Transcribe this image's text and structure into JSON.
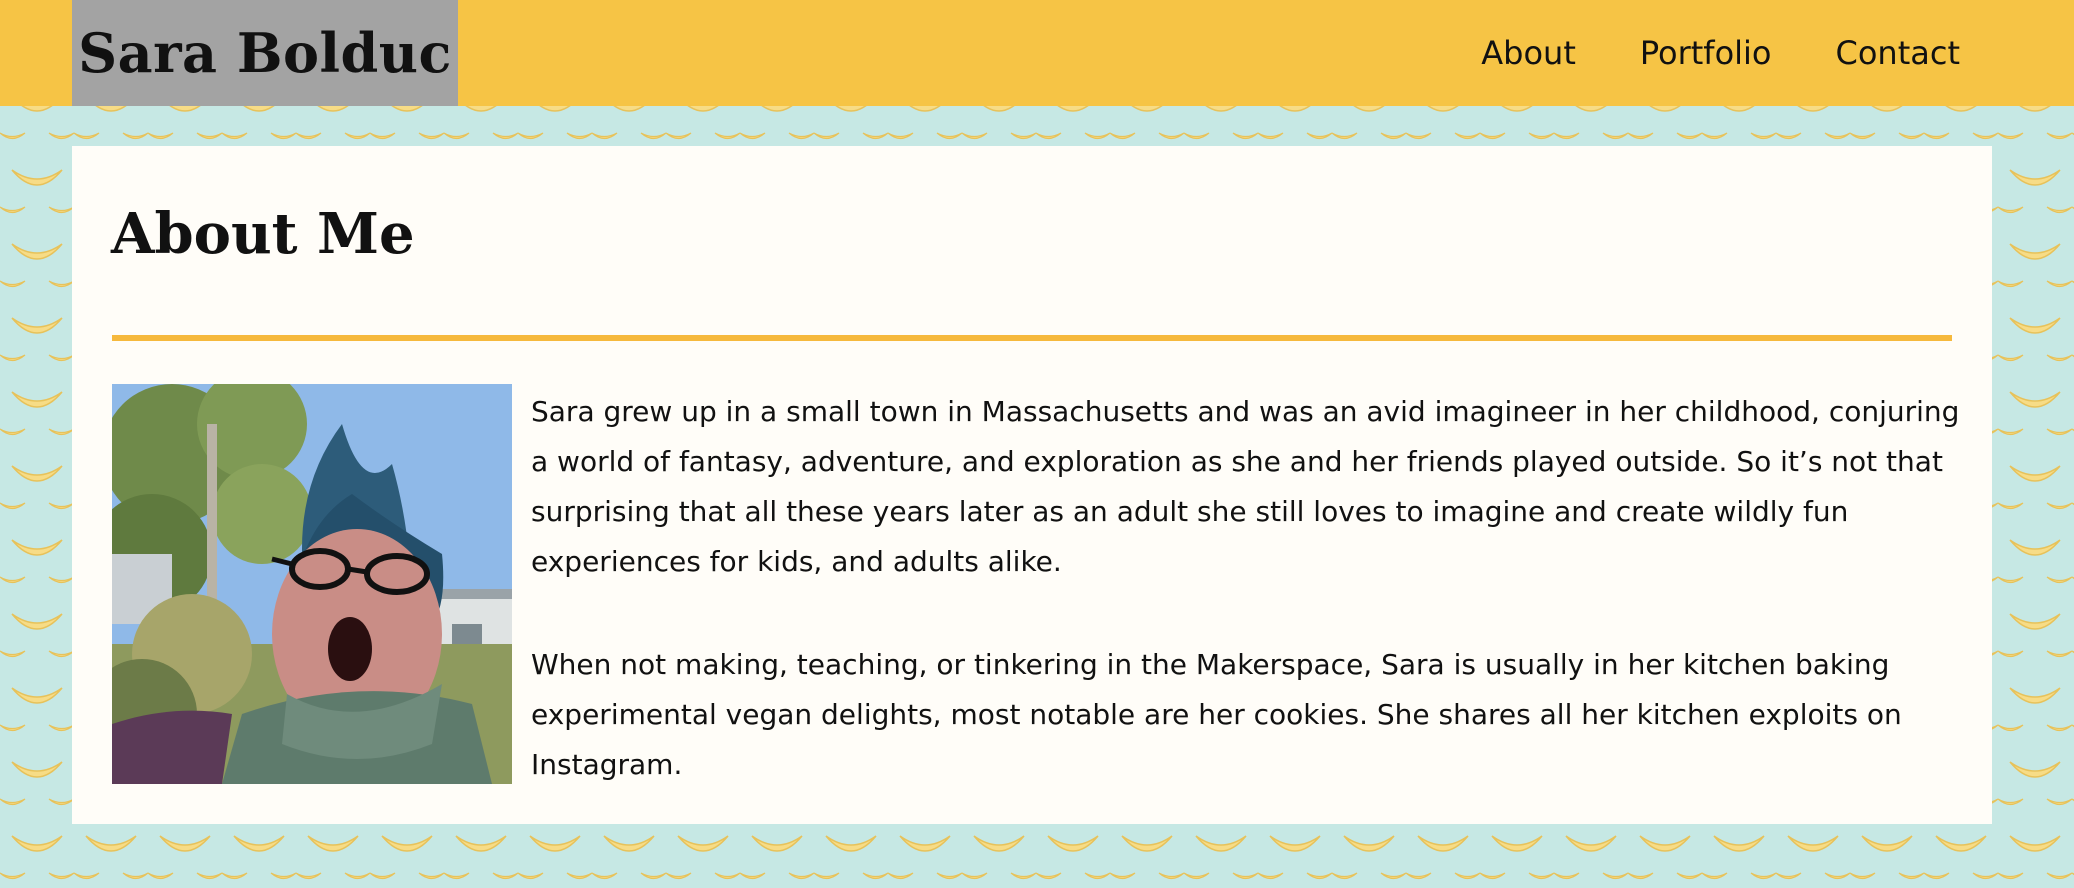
{
  "header": {
    "brand": "Sara Bolduc",
    "nav": [
      {
        "label": "About"
      },
      {
        "label": "Portfolio"
      },
      {
        "label": "Contact"
      }
    ]
  },
  "main": {
    "title": "About Me",
    "paragraphs": [
      "Sara grew up in a small town in Massachusetts and was an avid imagineer in her childhood, conjuring a world of fantasy, adventure, and exploration as she and her friends played outside. So it’s not that surprising that all these years later as an adult she still loves to imagine and create wildly fun experiences for kids, and adults alike.",
      "When not making, teaching, or tinkering in the Makerspace, Sara is usually in her kitchen baking experimental vegan delights, most notable are her cookies. She shares all her kitchen exploits on Instagram."
    ]
  },
  "colors": {
    "header_bg": "#f6c445",
    "brand_bg": "#a3a3a3",
    "page_bg": "#c6e8e4",
    "card_bg": "#fffdf8",
    "rule": "#f6b93d",
    "banana": "#f7dc86"
  }
}
